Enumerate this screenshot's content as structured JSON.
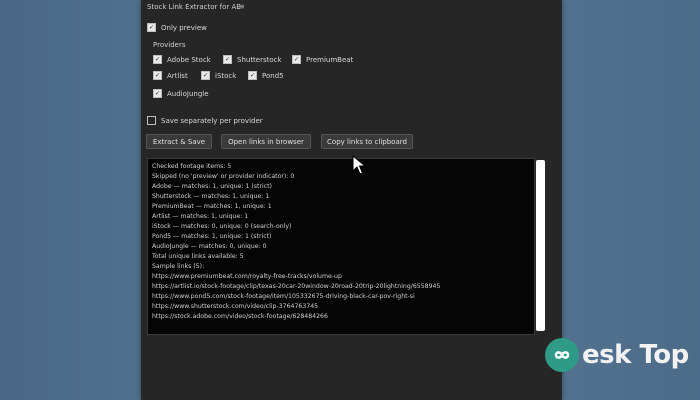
{
  "panel": {
    "title": "Stock Link Extractor for AE",
    "menu_icon": "menu-icon"
  },
  "options": {
    "only_preview": {
      "label": "Only preview",
      "checked": true
    },
    "save_separately": {
      "label": "Save separately per provider",
      "checked": false
    }
  },
  "providers": {
    "label": "Providers",
    "items": [
      {
        "label": "Adobe Stock",
        "checked": true
      },
      {
        "label": "Shutterstock",
        "checked": true
      },
      {
        "label": "PremiumBeat",
        "checked": true
      },
      {
        "label": "Artlist",
        "checked": true
      },
      {
        "label": "iStock",
        "checked": true
      },
      {
        "label": "Pond5",
        "checked": true
      },
      {
        "label": "AudioJungle",
        "checked": true
      }
    ]
  },
  "buttons": {
    "extract": "Extract & Save",
    "open_links": "Open links in browser",
    "copy_links": "Copy links to clipboard"
  },
  "output": {
    "lines": [
      "Checked footage items: 5",
      "Skipped (no 'preview' or provider indicator): 0",
      "Adobe — matches: 1, unique: 1 (strict)",
      "Shutterstock — matches: 1, unique: 1",
      "PremiumBeat — matches: 1, unique: 1",
      "Artlist — matches: 1, unique: 1",
      "iStock — matches: 0, unique: 0 (search-only)",
      "Pond5 — matches: 1, unique: 1 (strict)",
      "AudioJungle — matches: 0, unique: 0",
      "Total unique links available: 5",
      "Sample links (5):",
      "https://www.premiumbeat.com/royalty-free-tracks/volume-up",
      "https://artlist.io/stock-footage/clip/texas-20car-20window-20road-20trip-20lightning/6558945",
      "https://www.pond5.com/stock-footage/item/105332675-driving-black-car-pov-right-si",
      "https://www.shutterstock.com/video/clip-3764763745",
      "https://stock.adobe.com/video/stock-footage/628484266"
    ]
  },
  "watermark": {
    "text": "esk Top"
  },
  "colors": {
    "panel_bg": "#262626",
    "output_bg": "#050505",
    "desktop_bg": "#4f6f8d",
    "watermark_accent": "#2f9a86"
  }
}
